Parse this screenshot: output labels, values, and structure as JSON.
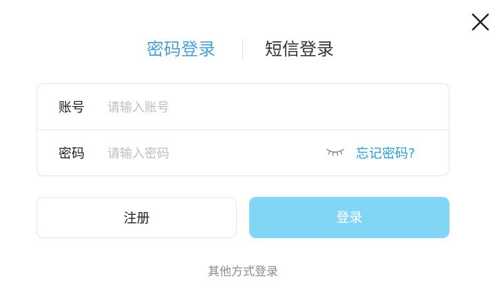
{
  "close_icon": "close-icon",
  "tabs": {
    "password_login": "密码登录",
    "sms_login": "短信登录",
    "active_color": "#4a9fd4",
    "inactive_color": "#333333"
  },
  "form": {
    "account": {
      "label": "账号",
      "placeholder": "请输入账号",
      "value": ""
    },
    "password": {
      "label": "密码",
      "placeholder": "请输入密码",
      "value": "",
      "toggle_icon": "eye-closed-icon",
      "forgot_label": "忘记密码?"
    }
  },
  "buttons": {
    "register_label": "注册",
    "login_label": "登录",
    "login_color": "#82d6f5"
  },
  "other_login_label": "其他方式登录"
}
